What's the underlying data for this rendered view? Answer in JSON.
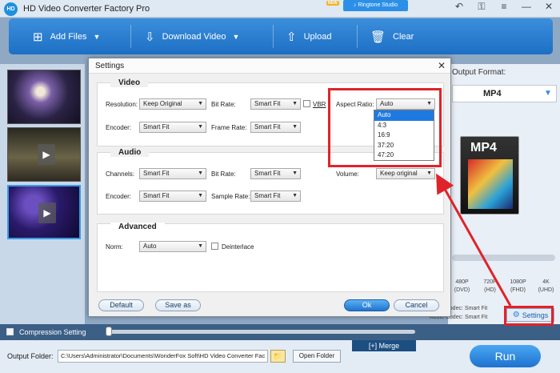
{
  "app": {
    "title": "HD Video Converter Factory Pro",
    "logo": "HD",
    "new_badge": "NEW",
    "ringtone_studio": "Ringtone Studio"
  },
  "toolbar": {
    "add_files": "Add Files",
    "download_video": "Download Video",
    "upload": "Upload",
    "clear": "Clear"
  },
  "output_format": {
    "label": "Output Format:",
    "value": "MP4",
    "icon_text": "MP4",
    "resolutions": [
      {
        "res": "480P",
        "sub": "(DVD)"
      },
      {
        "res": "720P",
        "sub": "(HD)"
      },
      {
        "res": "1080P",
        "sub": "(FHD)"
      },
      {
        "res": "4K",
        "sub": "(UHD)"
      }
    ],
    "video_codec": "Video Codec: Smart Fit",
    "audio_codec": "Audio Codec: Smart Fit",
    "settings_label": "Settings"
  },
  "compression": {
    "label": "Compression Setting"
  },
  "merge_label": "Merge",
  "output": {
    "label": "Output Folder:",
    "path": "C:\\Users\\Administrator\\Documents\\WonderFox Soft\\HD Video Converter Fac",
    "open_folder": "Open Folder",
    "run": "Run"
  },
  "dialog": {
    "title": "Settings",
    "video": {
      "title": "Video",
      "resolution_label": "Resolution:",
      "resolution_value": "Keep Original",
      "bitrate_label": "Bit Rate:",
      "bitrate_value": "Smart Fit",
      "vbr_label": "VBR",
      "aspect_label": "Aspect Ratio:",
      "aspect_value": "Auto",
      "encoder_label": "Encoder:",
      "encoder_value": "Smart Fit",
      "framerate_label": "Frame Rate:",
      "framerate_value": "Smart Fit"
    },
    "aspect_options": [
      "Auto",
      "4:3",
      "16:9",
      "37:20",
      "47:20"
    ],
    "audio": {
      "title": "Audio",
      "channels_label": "Channels:",
      "channels_value": "Smart Fit",
      "bitrate_label": "Bit Rate:",
      "bitrate_value": "Smart Fit",
      "volume_label": "Volume:",
      "volume_value": "Keep original",
      "encoder_label": "Encoder:",
      "encoder_value": "Smart Fit",
      "samplerate_label": "Sample Rate:",
      "samplerate_value": "Smart Fit"
    },
    "advanced": {
      "title": "Advanced",
      "norm_label": "Norm:",
      "norm_value": "Auto",
      "deinterlace_label": "Deinterlace"
    },
    "buttons": {
      "default": "Default",
      "save_as": "Save as",
      "ok": "Ok",
      "cancel": "Cancel"
    }
  },
  "colors": {
    "accent": "#1e72cf",
    "highlight_red": "#e0232a"
  }
}
